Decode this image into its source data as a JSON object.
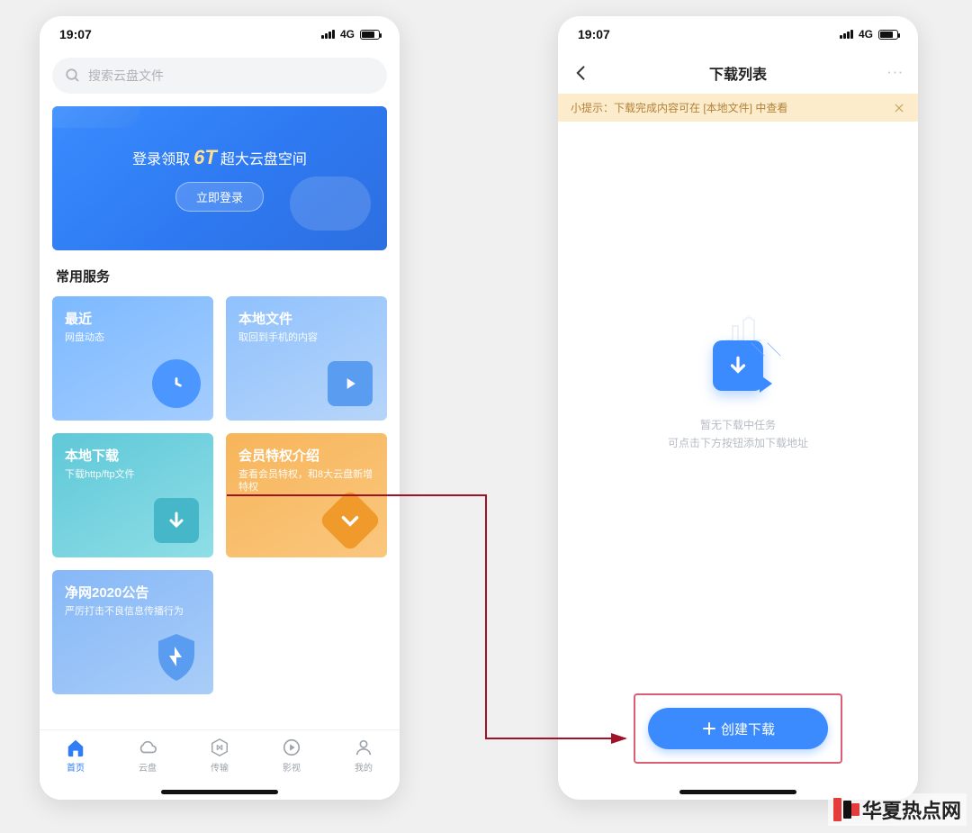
{
  "status": {
    "time": "19:07",
    "network": "4G"
  },
  "left": {
    "search_placeholder": "搜索云盘文件",
    "banner": {
      "part1": "登录领取",
      "highlight": "6T",
      "part2": "超大云盘空间",
      "login_btn": "立即登录"
    },
    "section_title": "常用服务",
    "cards": {
      "recent": {
        "title": "最近",
        "sub": "网盘动态"
      },
      "local": {
        "title": "本地文件",
        "sub": "取回到手机的内容"
      },
      "download": {
        "title": "本地下载",
        "sub": "下载http/ftp文件"
      },
      "vip": {
        "title": "会员特权介绍",
        "sub": "查看会员特权，和8大云盘新增特权"
      },
      "notice": {
        "title": "净网2020公告",
        "sub": "严厉打击不良信息传播行为"
      }
    },
    "tabs": {
      "home": "首页",
      "cloud": "云盘",
      "transfer": "传输",
      "video": "影视",
      "mine": "我的"
    }
  },
  "right": {
    "title": "下载列表",
    "tip": "小提示：下载完成内容可在 [本地文件] 中查看",
    "empty_line1": "暂无下载中任务",
    "empty_line2": "可点击下方按钮添加下载地址",
    "create_btn": "创建下载"
  },
  "watermark": "华夏热点网"
}
